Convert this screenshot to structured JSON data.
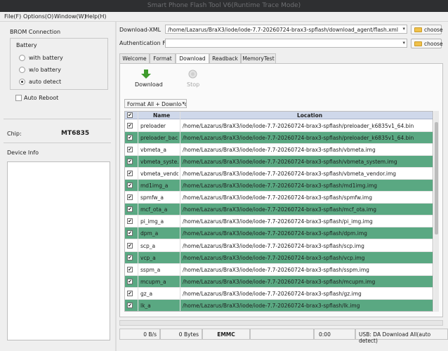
{
  "window": {
    "title": "Smart Phone Flash Tool V6(Runtime Trace Mode)"
  },
  "menu": [
    "File(F)",
    "Options(O)",
    "Window(W)",
    "Help(H)"
  ],
  "left_panel": {
    "brom_title": "BROM Connection",
    "battery_title": "Battery",
    "battery_options": [
      {
        "label": "with battery",
        "selected": false
      },
      {
        "label": "w/o battery",
        "selected": false
      },
      {
        "label": "auto detect",
        "selected": true
      }
    ],
    "auto_reboot": "Auto Reboot",
    "chip_label": "Chip:",
    "chip_value": "MT6835",
    "device_info": "Device Info"
  },
  "download_xml": {
    "label": "Download-XML",
    "value": "/home/Lazarus/BraX3/iode/iode-7.7-20260724-brax3-spflash/download_agent/flash.xml",
    "choose": "choose"
  },
  "auth_file": {
    "label": "Authentication File",
    "value": "",
    "choose": "choose"
  },
  "tabs": [
    "Welcome",
    "Format",
    "Download",
    "Readback",
    "MemoryTest"
  ],
  "active_tab": "Download",
  "toolbar": {
    "download": "Download",
    "stop": "Stop"
  },
  "mode_select": "Format All + Download",
  "table": {
    "headers": [
      "Name",
      "Location"
    ],
    "rows": [
      {
        "name": "preloader",
        "location": "/home/Lazarus/BraX3/iode/iode-7.7-20260724-brax3-spflash/preloader_k6835v1_64.bin",
        "green": false
      },
      {
        "name": "preloader_bac...",
        "location": "/home/Lazarus/BraX3/iode/iode-7.7-20260724-brax3-spflash/preloader_k6835v1_64.bin",
        "green": true
      },
      {
        "name": "vbmeta_a",
        "location": "/home/Lazarus/BraX3/iode/iode-7.7-20260724-brax3-spflash/vbmeta.img",
        "green": false
      },
      {
        "name": "vbmeta_syste...",
        "location": "/home/Lazarus/BraX3/iode/iode-7.7-20260724-brax3-spflash/vbmeta_system.img",
        "green": true
      },
      {
        "name": "vbmeta_vendo...",
        "location": "/home/Lazarus/BraX3/iode/iode-7.7-20260724-brax3-spflash/vbmeta_vendor.img",
        "green": false
      },
      {
        "name": "md1img_a",
        "location": "/home/Lazarus/BraX3/iode/iode-7.7-20260724-brax3-spflash/md1img.img",
        "green": true
      },
      {
        "name": "spmfw_a",
        "location": "/home/Lazarus/BraX3/iode/iode-7.7-20260724-brax3-spflash/spmfw.img",
        "green": false
      },
      {
        "name": "mcf_ota_a",
        "location": "/home/Lazarus/BraX3/iode/iode-7.7-20260724-brax3-spflash/mcf_ota.img",
        "green": true
      },
      {
        "name": "pi_img_a",
        "location": "/home/Lazarus/BraX3/iode/iode-7.7-20260724-brax3-spflash/pi_img.img",
        "green": false
      },
      {
        "name": "dpm_a",
        "location": "/home/Lazarus/BraX3/iode/iode-7.7-20260724-brax3-spflash/dpm.img",
        "green": true
      },
      {
        "name": "scp_a",
        "location": "/home/Lazarus/BraX3/iode/iode-7.7-20260724-brax3-spflash/scp.img",
        "green": false
      },
      {
        "name": "vcp_a",
        "location": "/home/Lazarus/BraX3/iode/iode-7.7-20260724-brax3-spflash/vcp.img",
        "green": true
      },
      {
        "name": "sspm_a",
        "location": "/home/Lazarus/BraX3/iode/iode-7.7-20260724-brax3-spflash/sspm.img",
        "green": false
      },
      {
        "name": "mcupm_a",
        "location": "/home/Lazarus/BraX3/iode/iode-7.7-20260724-brax3-spflash/mcupm.img",
        "green": true
      },
      {
        "name": "gz_a",
        "location": "/home/Lazarus/BraX3/iode/iode-7.7-20260724-brax3-spflash/gz.img",
        "green": false
      },
      {
        "name": "lk_a",
        "location": "/home/Lazarus/BraX3/iode/iode-7.7-20260724-brax3-spflash/lk.img",
        "green": true
      }
    ]
  },
  "status": {
    "speed": "0 B/s",
    "bytes": "0 Bytes",
    "storage": "EMMC",
    "time": "0:00",
    "usb": "USB: DA Download All(auto detect)"
  },
  "colors": {
    "row_green": "#5aa882",
    "header": "#cfd8ea",
    "titlebar": "#2e2f31"
  }
}
